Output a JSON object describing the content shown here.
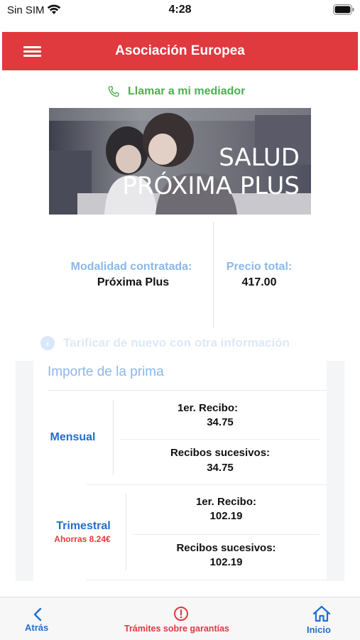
{
  "status_bar": {
    "carrier": "Sin SIM",
    "time": "4:28"
  },
  "header": {
    "title": "Asociación Europea",
    "menu_icon": "hamburger-menu-icon"
  },
  "call": {
    "label": "Llamar a mi mediador",
    "icon": "phone-icon",
    "color": "#4caf50"
  },
  "banner": {
    "line1": "SALUD",
    "line2": "PRÓXIMA PLUS"
  },
  "summary": {
    "modalidad_label": "Modalidad contratada:",
    "modalidad_value": "Próxima Plus",
    "precio_label": "Precio total:",
    "precio_value": "417.00"
  },
  "retarify": {
    "label": "Tarificar de nuevo con otra información",
    "icon": "chevron-left-circle-icon"
  },
  "premium": {
    "title": "Importe de la prima",
    "rows": [
      {
        "period": "Mensual",
        "first_label": "1er. Recibo:",
        "first_value": "34.75",
        "next_label": "Recibos sucesivos:",
        "next_value": "34.75"
      },
      {
        "period": "Trimestral",
        "savings": "Ahorras 8.24€",
        "first_label": "1er. Recibo:",
        "first_value": "102.19",
        "next_label": "Recibos sucesivos:",
        "next_value": "102.19"
      }
    ]
  },
  "tabbar": {
    "back_label": "Atrás",
    "guarantees_label": "Trámites sobre garantías",
    "home_label": "Inicio"
  },
  "colors": {
    "header": "#e0393e",
    "accent_blue": "#1f6fcf",
    "label_blue": "#8bb8e8",
    "savings_red": "#e0393e"
  }
}
